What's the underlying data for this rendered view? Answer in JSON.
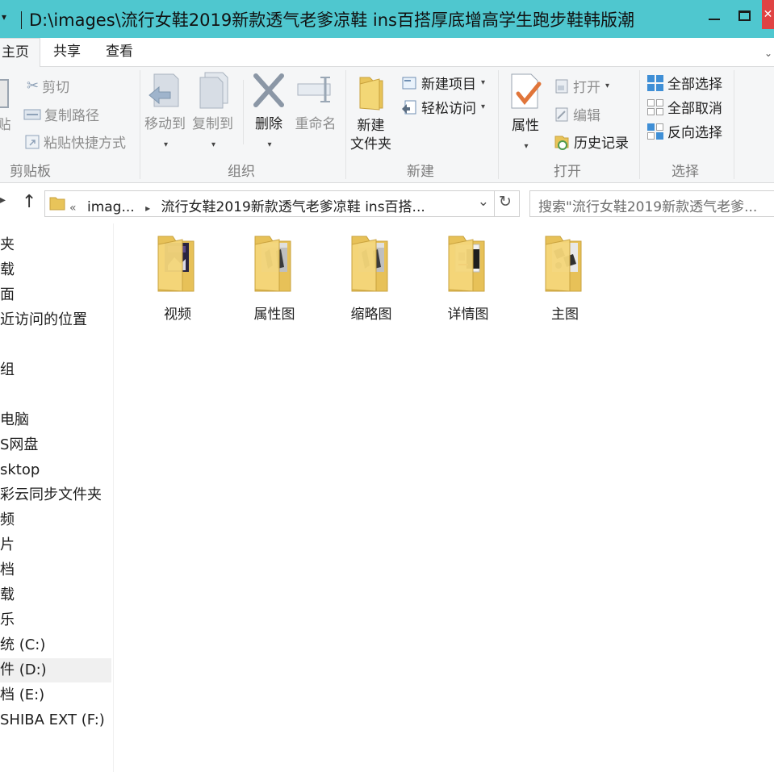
{
  "window": {
    "title": "D:\\images\\流行女鞋2019新款透气老爹凉鞋 ins百搭厚底增高学生跑步鞋韩版潮",
    "min_icon": "minimize-icon",
    "max_icon": "maximize-icon",
    "close_icon": "close-icon"
  },
  "tabs": [
    "主页",
    "共享",
    "查看"
  ],
  "ribbon": {
    "clipboard": {
      "cut": "剪切",
      "copy_path": "复制路径",
      "paste_shortcut": "粘贴快捷方式",
      "paste": "贴",
      "label": "剪贴板"
    },
    "organize": {
      "move_to": "移动到",
      "copy_to": "复制到",
      "delete": "删除",
      "rename": "重命名",
      "label": "组织"
    },
    "new": {
      "new_folder_l1": "新建",
      "new_folder_l2": "文件夹",
      "new_item": "新建项目",
      "easy_access": "轻松访问",
      "label": "新建"
    },
    "open": {
      "properties": "属性",
      "open": "打开",
      "edit": "编辑",
      "history": "历史记录",
      "label": "打开"
    },
    "select": {
      "select_all": "全部选择",
      "select_none": "全部取消",
      "invert": "反向选择",
      "label": "选择"
    }
  },
  "address": {
    "prefix": "«",
    "part1": "imag...",
    "part2": "流行女鞋2019新款透气老爹凉鞋 ins百搭...",
    "search_placeholder": "搜索\"流行女鞋2019新款透气老爹..."
  },
  "nav_pane": [
    {
      "label": "夹",
      "selected": false
    },
    {
      "label": "载",
      "selected": false
    },
    {
      "label": "面",
      "selected": false
    },
    {
      "label": "近访问的位置",
      "selected": false
    },
    {
      "label": "组",
      "selected": false
    },
    {
      "label": "电脑",
      "selected": false
    },
    {
      "label": "S网盘",
      "selected": false
    },
    {
      "label": "sktop",
      "selected": false
    },
    {
      "label": "彩云同步文件夹",
      "selected": false
    },
    {
      "label": "频",
      "selected": false
    },
    {
      "label": "片",
      "selected": false
    },
    {
      "label": "档",
      "selected": false
    },
    {
      "label": "载",
      "selected": false
    },
    {
      "label": "乐",
      "selected": false
    },
    {
      "label": "统 (C:)",
      "selected": false
    },
    {
      "label": "件 (D:)",
      "selected": true
    },
    {
      "label": "档 (E:)",
      "selected": false
    },
    {
      "label": "SHIBA EXT (F:)",
      "selected": false
    }
  ],
  "folders": [
    {
      "label": "视频",
      "thumb": "dark-video"
    },
    {
      "label": "属性图",
      "thumb": "shoes-gray"
    },
    {
      "label": "缩略图",
      "thumb": "shoes-gray"
    },
    {
      "label": "详情图",
      "thumb": "detail-page"
    },
    {
      "label": "主图",
      "thumb": "shoes-bw"
    }
  ]
}
